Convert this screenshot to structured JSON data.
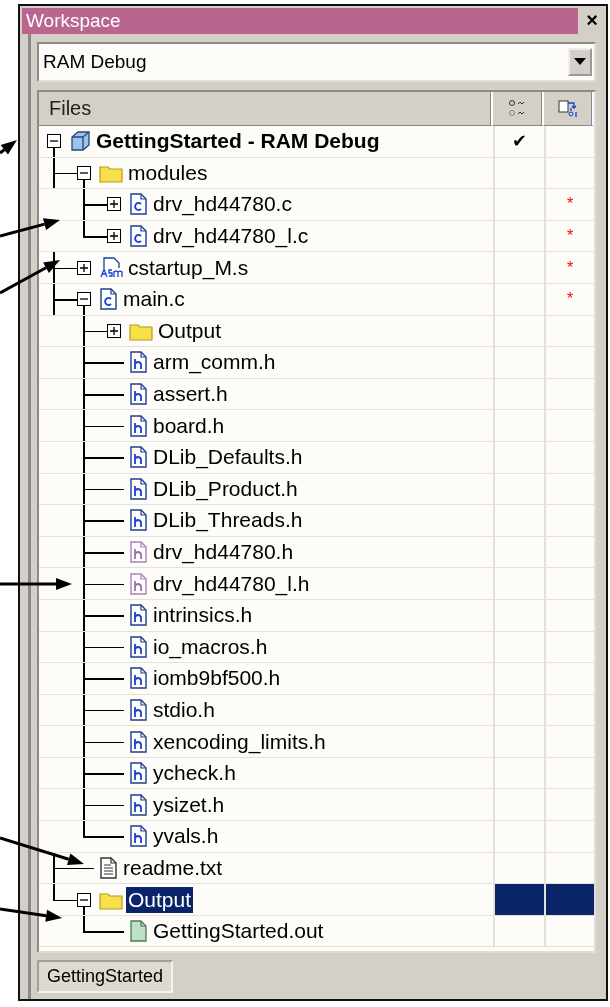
{
  "window": {
    "title": "Workspace",
    "close": "×"
  },
  "configuration": {
    "value": "RAM Debug"
  },
  "files": {
    "column_1": "Files",
    "tree": [
      {
        "name": "GettingStarted - RAM Debug",
        "kind": "project",
        "expanded": true,
        "selected": false,
        "excluded": false,
        "column_2": "✔",
        "children": [
          {
            "name": "modules",
            "kind": "folder",
            "expanded": true,
            "selected": false,
            "excluded": false,
            "children": [
              {
                "name": "drv_hd44780.c",
                "kind": "c",
                "expanded": false,
                "selected": false,
                "excluded": false,
                "column_3": "*"
              },
              {
                "name": "drv_hd44780_l.c",
                "kind": "c",
                "expanded": false,
                "selected": false,
                "excluded": false,
                "column_3": "*"
              }
            ]
          },
          {
            "name": "cstartup_M.s",
            "kind": "asm",
            "expanded": false,
            "selected": false,
            "excluded": false,
            "column_3": "*"
          },
          {
            "name": "main.c",
            "kind": "c",
            "expanded": true,
            "selected": false,
            "excluded": false,
            "column_3": "*",
            "children": [
              {
                "name": "Output",
                "kind": "folder",
                "expanded": false,
                "selected": false,
                "excluded": false
              },
              {
                "name": "arm_comm.h",
                "kind": "h",
                "selected": false,
                "excluded": false
              },
              {
                "name": "assert.h",
                "kind": "h",
                "selected": false,
                "excluded": false
              },
              {
                "name": "board.h",
                "kind": "h",
                "selected": false,
                "excluded": false
              },
              {
                "name": "DLib_Defaults.h",
                "kind": "h",
                "selected": false,
                "excluded": false
              },
              {
                "name": "DLib_Product.h",
                "kind": "h",
                "selected": false,
                "excluded": false
              },
              {
                "name": "DLib_Threads.h",
                "kind": "h",
                "selected": false,
                "excluded": false
              },
              {
                "name": "drv_hd44780.h",
                "kind": "h",
                "selected": false,
                "excluded": true
              },
              {
                "name": "drv_hd44780_l.h",
                "kind": "h",
                "selected": false,
                "excluded": true
              },
              {
                "name": "intrinsics.h",
                "kind": "h",
                "selected": false,
                "excluded": false
              },
              {
                "name": "io_macros.h",
                "kind": "h",
                "selected": false,
                "excluded": false
              },
              {
                "name": "iomb9bf500.h",
                "kind": "h",
                "selected": false,
                "excluded": false
              },
              {
                "name": "stdio.h",
                "kind": "h",
                "selected": false,
                "excluded": false
              },
              {
                "name": "xencoding_limits.h",
                "kind": "h",
                "selected": false,
                "excluded": false
              },
              {
                "name": "ycheck.h",
                "kind": "h",
                "selected": false,
                "excluded": false
              },
              {
                "name": "ysizet.h",
                "kind": "h",
                "selected": false,
                "excluded": false
              },
              {
                "name": "yvals.h",
                "kind": "h",
                "selected": false,
                "excluded": false
              }
            ]
          },
          {
            "name": "readme.txt",
            "kind": "text",
            "selected": false,
            "excluded": false
          },
          {
            "name": "Output",
            "kind": "folder",
            "expanded": true,
            "selected": true,
            "excluded": false,
            "children": [
              {
                "name": "GettingStarted.out",
                "kind": "output",
                "selected": false,
                "excluded": false
              }
            ]
          }
        ]
      }
    ]
  },
  "tabs": [
    {
      "label": "GettingStarted",
      "selected": true
    }
  ]
}
